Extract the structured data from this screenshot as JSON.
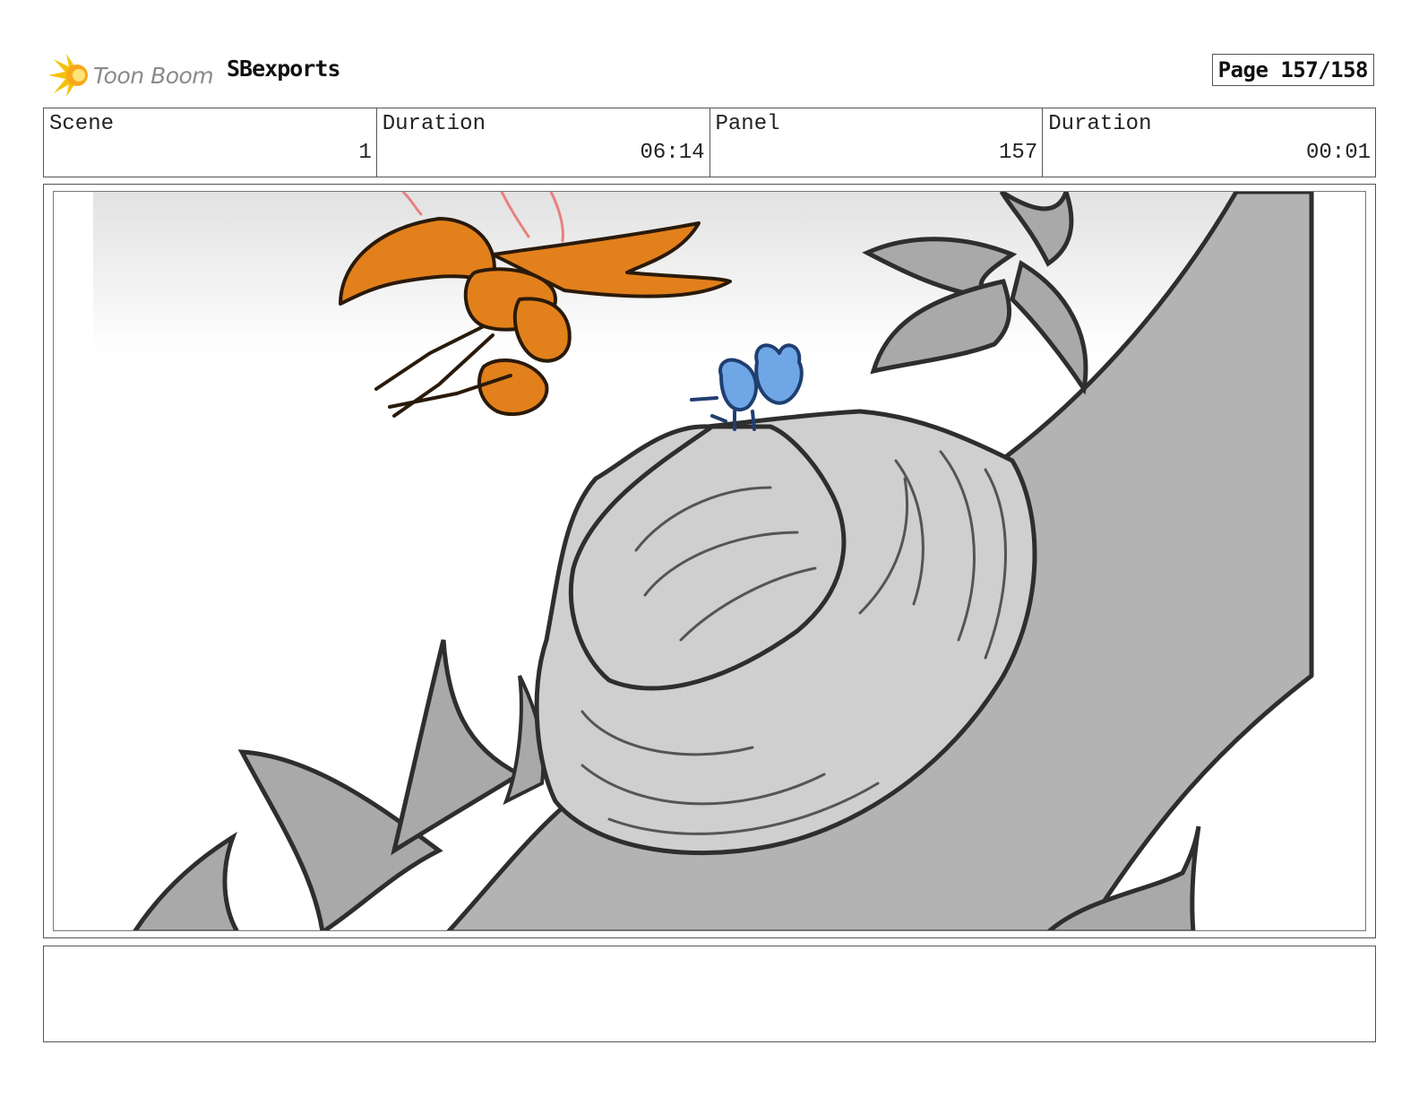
{
  "header": {
    "brand": "Toon Boom",
    "project": "SBexports",
    "page": "Page 157/158"
  },
  "info": {
    "scene_label": "Scene",
    "scene_value": "1",
    "scene_duration_label": "Duration",
    "scene_duration_value": "06:14",
    "panel_label": "Panel",
    "panel_value": "157",
    "panel_duration_label": "Duration",
    "panel_duration_value": "00:01"
  },
  "panel": {
    "colors": {
      "sky_gradient": "#e4e4e4",
      "branch_dark": "#b3b3b3",
      "stump_light": "#cfcfcf",
      "leaf_gray": "#a9a9a9",
      "wasp_orange": "#e2801c",
      "bug_blue": "#6fa6e6",
      "outline": "#2e2e2e"
    }
  },
  "notes": {
    "text": ""
  }
}
